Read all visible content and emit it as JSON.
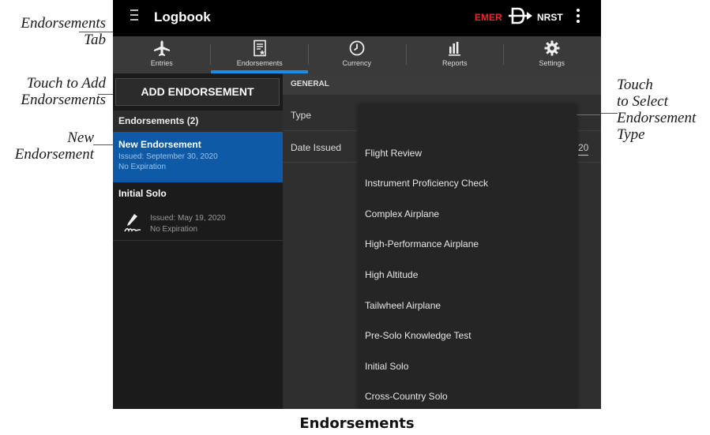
{
  "app": {
    "title": "Logbook",
    "emer_label": "EMER",
    "nrst_label": "NRST",
    "icons": {
      "menu": "hamburger-icon",
      "direct": "direct-to-icon",
      "more": "kebab-icon"
    }
  },
  "tabs": [
    {
      "label": "Entries",
      "icon": "airplane-icon"
    },
    {
      "label": "Endorsements",
      "icon": "endorsement-certificate-icon",
      "active": true
    },
    {
      "label": "Currency",
      "icon": "clock-icon"
    },
    {
      "label": "Reports",
      "icon": "bar-chart-icon"
    },
    {
      "label": "Settings",
      "icon": "gear-icon"
    }
  ],
  "colors": {
    "accent": "#1a8de8",
    "selected_row": "#0f5aa6",
    "emer": "#e8262b"
  },
  "left_panel": {
    "add_button": "ADD ENDORSEMENT",
    "list_header": "Endorsements (2)",
    "items": [
      {
        "title": "New Endorsement",
        "issued": "Issued: September 30, 2020",
        "expiration": "No Expiration",
        "selected": true
      },
      {
        "title": "Initial Solo",
        "issued": "Issued: May 19, 2020",
        "expiration": "No Expiration",
        "icon": "signature-icon"
      }
    ]
  },
  "right_panel": {
    "section": "GENERAL",
    "type_label": "Type",
    "date_label": "Date Issued",
    "date_value_fragment": "20"
  },
  "type_options": [
    "Flight Review",
    "Instrument Proficiency Check",
    "Complex Airplane",
    "High-Performance Airplane",
    "High Altitude",
    "Tailwheel Airplane",
    "Pre-Solo Knowledge Test",
    "Initial Solo",
    "Cross-Country Solo"
  ],
  "callouts": {
    "endorsements_tab": "Endorsements\nTab",
    "add": "Touch to Add\nEndorsements",
    "new": "New\nEndorsement",
    "select_type": "Touch\nto Select\nEndorsement\nType"
  },
  "caption": "Endorsements"
}
